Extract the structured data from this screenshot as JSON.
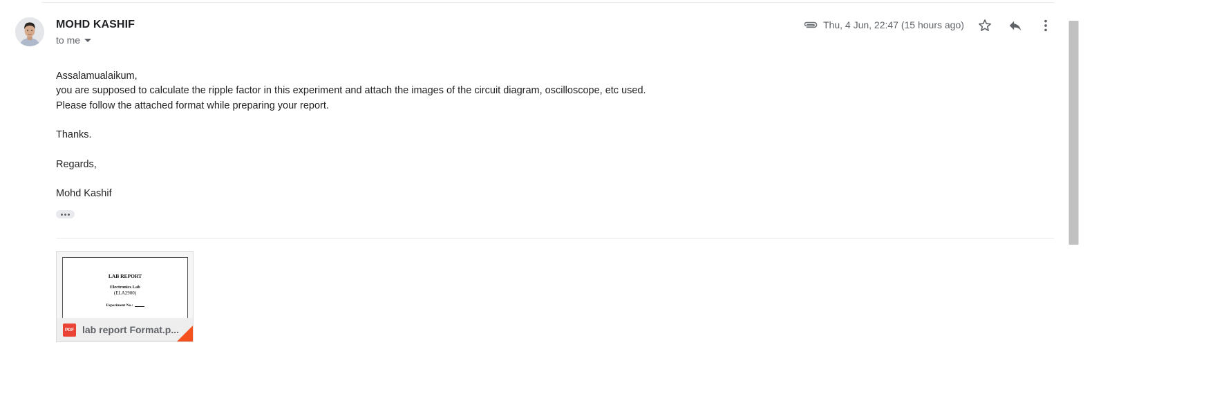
{
  "message": {
    "sender_name": "MOHD KASHIF",
    "recipient_label": "to me",
    "date_text": "Thu, 4 Jun, 22:47 (15 hours ago)",
    "body": {
      "greeting": "Assalamualaikum,",
      "line1": "you are supposed to calculate the ripple factor in this experiment and attach the images of the circuit diagram, oscilloscope, etc used.",
      "line2": "Please follow the attached format while preparing your report.",
      "thanks": "Thanks.",
      "regards": "Regards,",
      "signature": "Mohd Kashif"
    }
  },
  "icons": {
    "attachment": "paperclip-icon",
    "star": "star-icon",
    "reply": "reply-icon",
    "more": "more-vert-icon",
    "file_type": "pdf-icon"
  },
  "attachment": {
    "file_name": "lab report Format.p...",
    "type_label": "PDF",
    "preview": {
      "title": "LAB REPORT",
      "subtitle": "Electronics Lab",
      "code": "(ELA2900)",
      "experiment_label": "Experiment No.:"
    }
  },
  "colors": {
    "pdf_red": "#ea4335",
    "corner_orange": "#f4511e",
    "secondary_text": "#5f6368"
  }
}
